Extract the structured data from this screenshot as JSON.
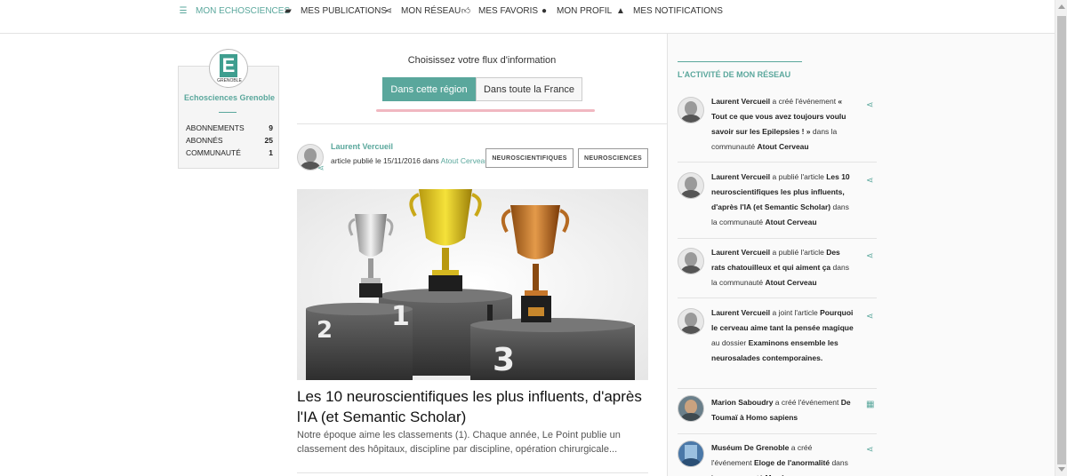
{
  "topnav": {
    "items": [
      {
        "label": "MON ECHOSCIENCES",
        "icon": "list-icon",
        "active": true
      },
      {
        "label": "MES PUBLICATIONS",
        "icon": "book-icon",
        "active": false
      },
      {
        "label": "MON RÉSEAU",
        "icon": "share-icon",
        "active": false
      },
      {
        "label": "MES FAVORIS",
        "icon": "thumbs-up-icon",
        "active": false
      },
      {
        "label": "MON PROFIL",
        "icon": "user-icon",
        "active": false
      },
      {
        "label": "MES NOTIFICATIONS",
        "icon": "bell-icon",
        "active": false
      }
    ]
  },
  "profile": {
    "logo_letter": "E",
    "logo_sub": "GRENOBLE",
    "name": "Echosciences Grenoble",
    "stats": [
      {
        "label": "ABONNEMENTS",
        "value": "9"
      },
      {
        "label": "ABONNÉS",
        "value": "25"
      },
      {
        "label": "COMMUNAUTÉ",
        "value": "1"
      }
    ]
  },
  "feed": {
    "title": "Choisissez votre flux d'information",
    "tabs": [
      {
        "label": "Dans cette région",
        "active": true
      },
      {
        "label": "Dans toute la France",
        "active": false
      }
    ]
  },
  "post": {
    "author": "Laurent Vercueil",
    "meta_prefix": "article publié le 15/11/2016 dans",
    "community": "Atout Cerveau",
    "tags": [
      "NEUROSCIENTIFIQUES",
      "NEUROSCIENCES"
    ],
    "headline": "Les 10 neuroscientifiques les plus influents, d'après l'IA (et Semantic Scholar)",
    "excerpt": "Notre époque aime les classements (1). Chaque année, Le Point publie un classement des hôpitaux, discipline par discipline, opération chirurgicale...",
    "podium_labels": [
      "2",
      "1",
      "3"
    ]
  },
  "activity": {
    "title": "L'ACTIVITÉ DE MON RÉSEAU",
    "items": [
      {
        "html": "<b>Laurent Vercueil</b> a créé l'événement <b>« Tout ce que vous avez toujours voulu savoir sur les Epilepsies ! »</b> dans la communauté <b>Atout Cerveau</b>",
        "icon": "share-icon"
      },
      {
        "html": "<b>Laurent Vercueil</b> a publié l'article <b>Les 10 neuroscientifiques les plus influents, d'après l'IA (et Semantic Scholar)</b> dans la communauté <b>Atout Cerveau</b>",
        "icon": "share-icon"
      },
      {
        "html": "<b>Laurent Vercueil</b> a publié l'article <b>Des rats chatouilleux et qui aiment ça</b> dans la communauté <b>Atout Cerveau</b>",
        "icon": "share-icon"
      },
      {
        "html": "<b>Laurent Vercueil</b> a joint l'article <b>Pourquoi le cerveau aime tant la pensée magique</b> au dossier <b>Examinons ensemble les neurosalades contemporaines.</b>",
        "icon": "share-icon"
      },
      {
        "html": "<b>Marion Saboudry</b> a créé l'événement <b>De Toumaï à Homo sapiens</b>",
        "icon": "calendar-icon"
      },
      {
        "html": "<b>Muséum De Grenoble</b> a créé l'événement <b>Eloge de l'anormalité</b> dans la communauté <b>Muséum</b>",
        "icon": "share-icon"
      }
    ]
  },
  "colors": {
    "accent": "#5aa79c",
    "highlight": "#f1b8c1"
  }
}
